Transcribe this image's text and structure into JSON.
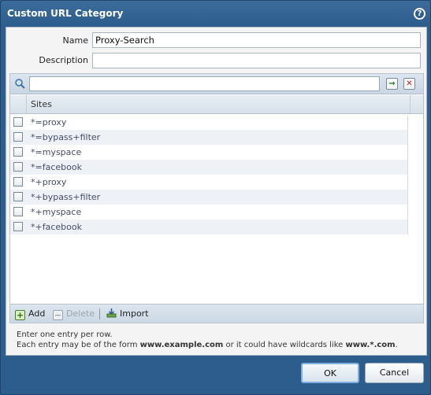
{
  "dialog": {
    "title": "Custom URL Category",
    "help_icon": "help-icon"
  },
  "form": {
    "name_label": "Name",
    "name_value": "Proxy-Search",
    "description_label": "Description",
    "description_value": ""
  },
  "grid": {
    "search_value": "",
    "column_header": "Sites",
    "rows": [
      "*=proxy",
      "*=bypass+filter",
      "*=myspace",
      "*=facebook",
      "*+proxy",
      "*+bypass+filter",
      "*+myspace",
      "*+facebook"
    ]
  },
  "toolbar": {
    "add_label": "Add",
    "delete_label": "Delete",
    "import_label": "Import"
  },
  "hint": {
    "line1": "Enter one entry per row.",
    "line2_a": "Each entry may be of the form ",
    "line2_b": "www.example.com",
    "line2_c": " or it could have wildcards like ",
    "line2_d": "www.*.com",
    "line2_e": "."
  },
  "buttons": {
    "ok_label": "OK",
    "cancel_label": "Cancel"
  },
  "colors": {
    "titlebar": "#2d5d8c",
    "panel": "#f4f4f4",
    "accent": "#7fb0e0"
  }
}
